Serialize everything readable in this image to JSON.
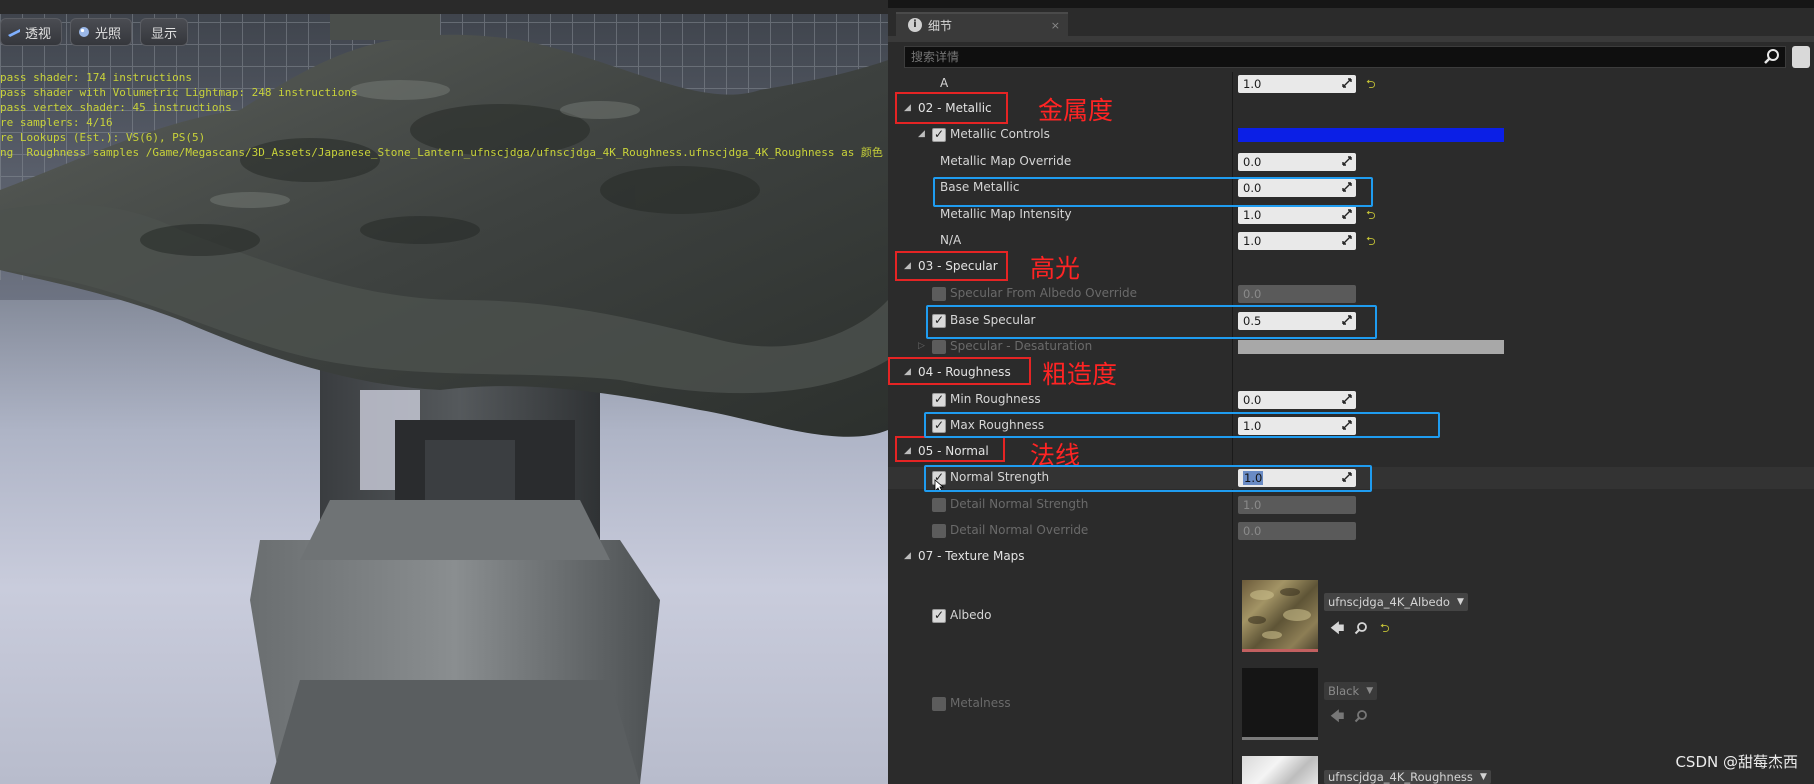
{
  "viewport": {
    "buttons": [
      {
        "label": "透视",
        "icon": "perspective-icon"
      },
      {
        "label": "光照",
        "icon": "lit-sphere-icon"
      },
      {
        "label": "显示",
        "icon": ""
      }
    ],
    "stats_lines": [
      "pass shader: 174 instructions",
      "pass shader with Volumetric Lightmap: 248 instructions",
      "pass vertex shader: 45 instructions",
      "re samplers: 4/16",
      "re Lookups (Est.): VS(6), PS(5)",
      "ng  Roughness samples /Game/Megascans/3D_Assets/Japanese_Stone_Lantern_ufnscjdga/ufnscjdga_4K_Roughness.ufnscjdga_4K_Roughness as 颜色"
    ]
  },
  "details": {
    "tab_label": "细节",
    "search_placeholder": "搜索详情",
    "row_a": {
      "label": "A",
      "value": "1.0"
    },
    "cat_metallic": "02 - Metallic",
    "metallic_controls": {
      "label": "Metallic Controls",
      "color": "#0b1fe6"
    },
    "metallic_map_override": {
      "label": "Metallic Map Override",
      "value": "0.0"
    },
    "base_metallic": {
      "label": "Base Metallic",
      "value": "0.0"
    },
    "metallic_map_intensity": {
      "label": "Metallic Map Intensity",
      "value": "1.0"
    },
    "na": {
      "label": "N/A",
      "value": "1.0"
    },
    "cat_specular": "03 - Specular",
    "specular_from_albedo": {
      "label": "Specular From Albedo Override",
      "value": "0.0"
    },
    "base_specular": {
      "label": "Base Specular",
      "value": "0.5"
    },
    "specular_desaturation": {
      "label": "Specular - Desaturation"
    },
    "cat_roughness": "04 - Roughness",
    "min_roughness": {
      "label": "Min Roughness",
      "value": "0.0"
    },
    "max_roughness": {
      "label": "Max Roughness",
      "value": "1.0"
    },
    "cat_normal": "05 - Normal",
    "normal_strength": {
      "label": "Normal Strength",
      "value": "1.0"
    },
    "detail_normal_strength": {
      "label": "Detail Normal Strength",
      "value": "1.0"
    },
    "detail_normal_override": {
      "label": "Detail Normal  Override",
      "value": "0.0"
    },
    "cat_texture_maps": "07 - Texture Maps",
    "albedo": {
      "label": "Albedo",
      "asset": "ufnscjdga_4K_Albedo"
    },
    "metalness": {
      "label": "Metalness",
      "asset": "Black"
    },
    "roughness_map": {
      "asset": "ufnscjdga_4K_Roughness"
    }
  },
  "annotations": {
    "metallic": "金属度",
    "specular": "高光",
    "roughness": "粗造度",
    "normal": "法线"
  },
  "watermark": "CSDN @甜莓杰西"
}
